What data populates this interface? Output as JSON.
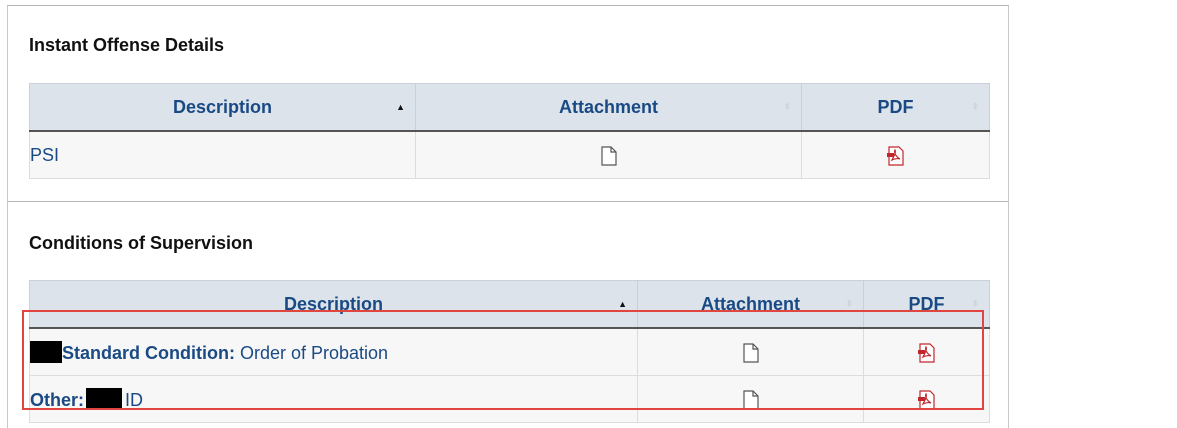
{
  "sections": [
    {
      "title": "Instant Offense Details",
      "columns": [
        "Description",
        "Attachment",
        "PDF"
      ],
      "rows": [
        {
          "description": "PSI"
        }
      ]
    },
    {
      "title": "Conditions of Supervision",
      "columns": [
        "Description",
        "Attachment",
        "PDF"
      ],
      "rows": [
        {
          "label": "Standard Condition:",
          "value": " Order of Probation"
        },
        {
          "label": "Other:",
          "value": "ID"
        }
      ]
    }
  ],
  "colors": {
    "header_bg": "#dce3ea",
    "header_text": "#1a4a84",
    "pdf_red": "#c0282d",
    "highlight": "#e0463f"
  },
  "icons": {
    "sort": "sort-asc-icon",
    "attachment": "file-icon",
    "pdf": "pdf-icon"
  }
}
